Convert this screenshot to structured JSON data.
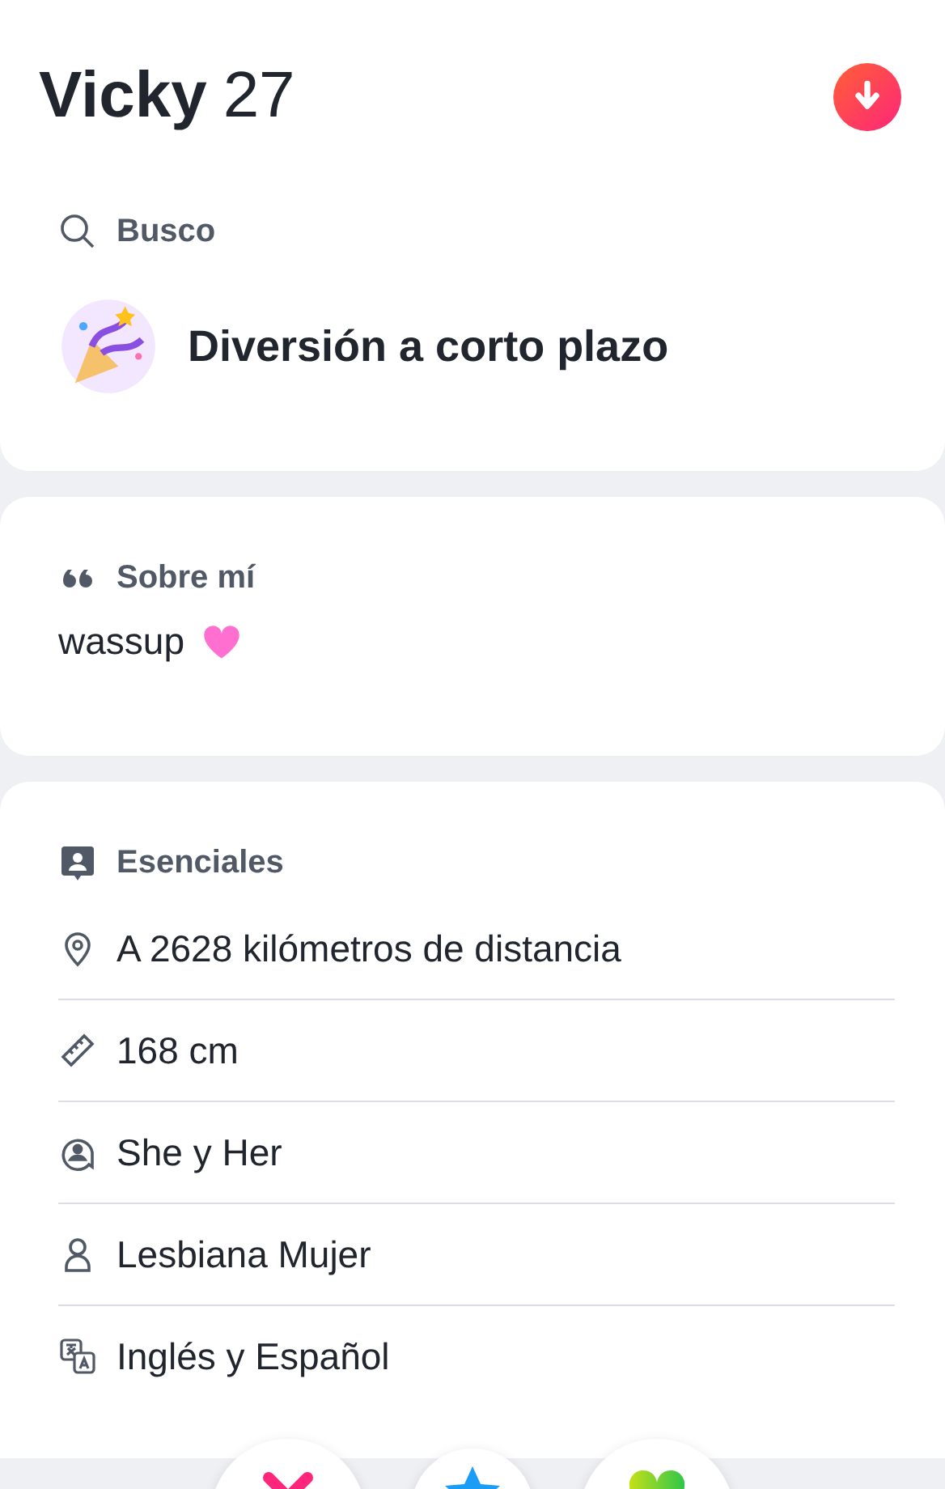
{
  "header": {
    "name": "Vicky",
    "age": "27"
  },
  "looking_for": {
    "title": "Busco",
    "value": "Diversión a corto plazo"
  },
  "about": {
    "title": "Sobre mí",
    "text": "wassup"
  },
  "essentials": {
    "title": "Esenciales",
    "items": [
      {
        "kind": "distance",
        "text": "A 2628 kilómetros de distancia"
      },
      {
        "kind": "height",
        "text": "168 cm"
      },
      {
        "kind": "pronouns",
        "text": "She y Her"
      },
      {
        "kind": "orientation",
        "text": "Lesbiana Mujer"
      },
      {
        "kind": "languages",
        "text": "Inglés y Español"
      }
    ]
  },
  "actions": [
    {
      "kind": "nope"
    },
    {
      "kind": "super_like"
    },
    {
      "kind": "like"
    }
  ]
}
